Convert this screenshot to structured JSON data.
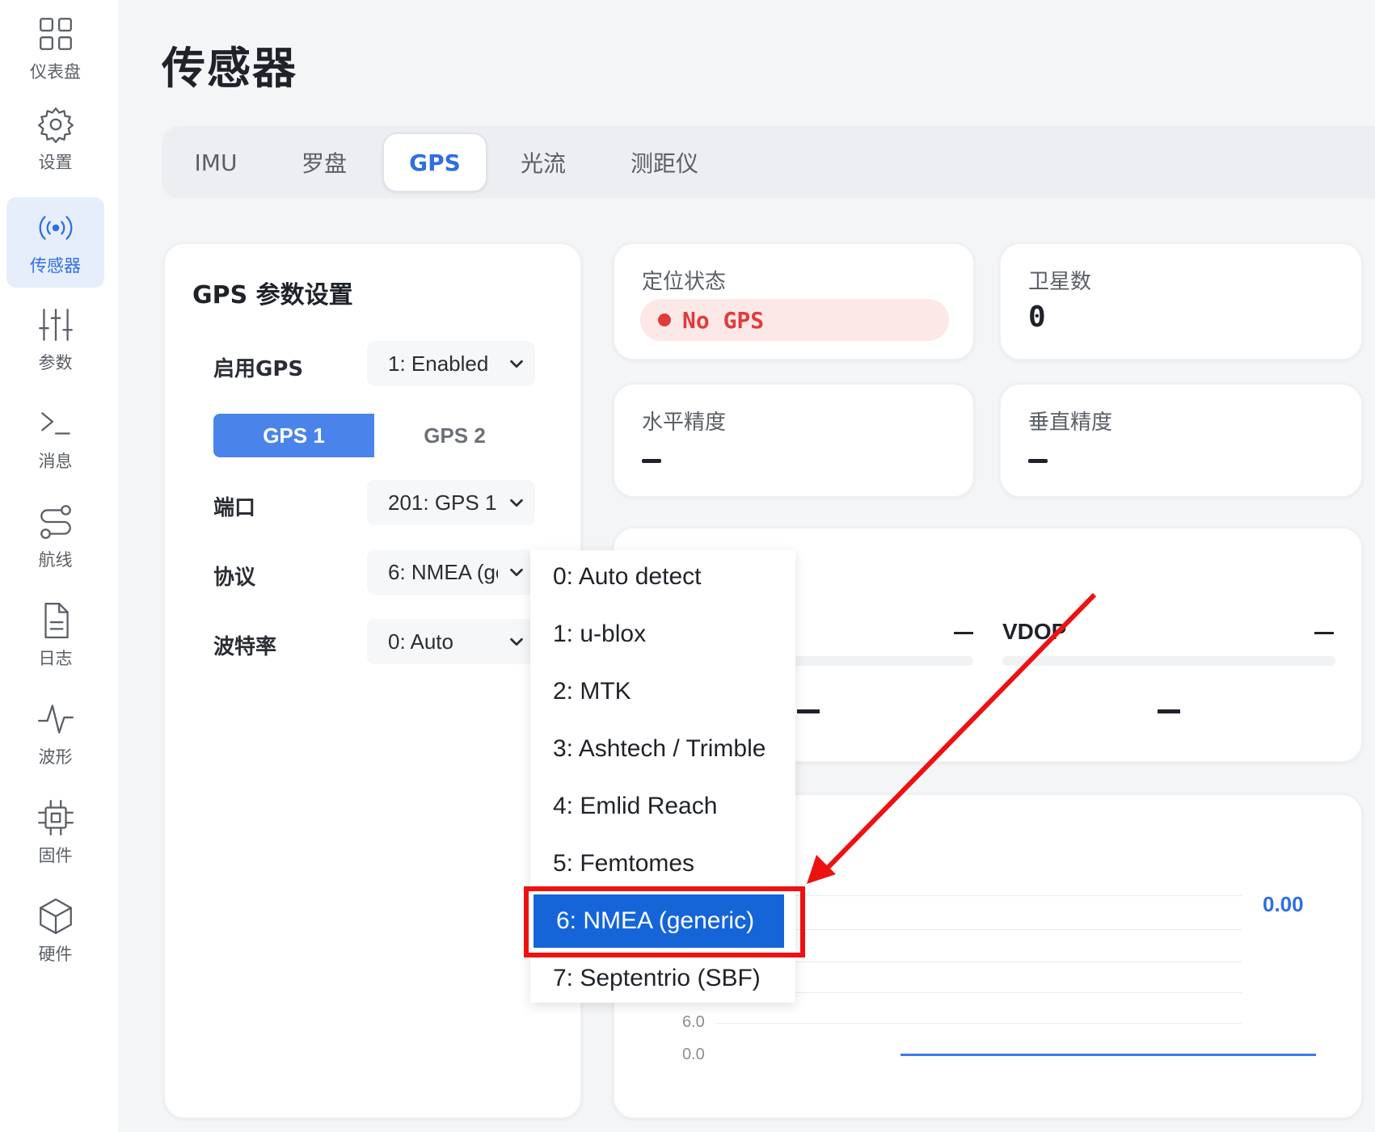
{
  "sidebar": {
    "items": [
      {
        "label": "仪表盘",
        "icon": "dashboard-grid-icon"
      },
      {
        "label": "设置",
        "icon": "gear-icon"
      },
      {
        "label": "传感器",
        "icon": "broadcast-icon",
        "active": true
      },
      {
        "label": "参数",
        "icon": "sliders-icon"
      },
      {
        "label": "消息",
        "icon": "terminal-icon"
      },
      {
        "label": "航线",
        "icon": "route-icon"
      },
      {
        "label": "日志",
        "icon": "document-icon"
      },
      {
        "label": "波形",
        "icon": "waveform-icon"
      },
      {
        "label": "固件",
        "icon": "chip-icon"
      },
      {
        "label": "硬件",
        "icon": "cube-icon"
      }
    ]
  },
  "page": {
    "title": "传感器"
  },
  "tabs": [
    {
      "label": "IMU"
    },
    {
      "label": "罗盘"
    },
    {
      "label": "GPS",
      "active": true
    },
    {
      "label": "光流"
    },
    {
      "label": "测距仪"
    }
  ],
  "gps_settings": {
    "title": "GPS 参数设置",
    "enable": {
      "label": "启用GPS",
      "value": "1: Enabled"
    },
    "segments": [
      "GPS 1",
      "GPS 2"
    ],
    "port": {
      "label": "端口",
      "value": "201: GPS 1"
    },
    "protocol": {
      "label": "协议",
      "value": "6: NMEA (generic)"
    },
    "baud": {
      "label": "波特率",
      "value": "0: Auto"
    }
  },
  "status": {
    "fix": {
      "title": "定位状态",
      "value": "No GPS"
    },
    "satellites": {
      "title": "卫星数",
      "value": "0"
    },
    "h_accuracy": {
      "title": "水平精度"
    },
    "v_accuracy": {
      "title": "垂直精度"
    }
  },
  "dop": {
    "vdop_label": "VDOP"
  },
  "chart": {
    "current_value": "0.00",
    "ticks": [
      "6.0",
      "0.0"
    ]
  },
  "protocol_dropdown": {
    "options": [
      "0: Auto detect",
      "1: u-blox",
      "2: MTK",
      "3: Ashtech / Trimble",
      "4: Emlid Reach",
      "5: Femtomes",
      "6: NMEA (generic)",
      "7: Septentrio (SBF)"
    ],
    "selected_index": 6
  },
  "colors": {
    "accent": "#2f6fe0",
    "selected_option": "#1565d8",
    "error": "#e03b3b",
    "annotation": "#ee1111"
  }
}
